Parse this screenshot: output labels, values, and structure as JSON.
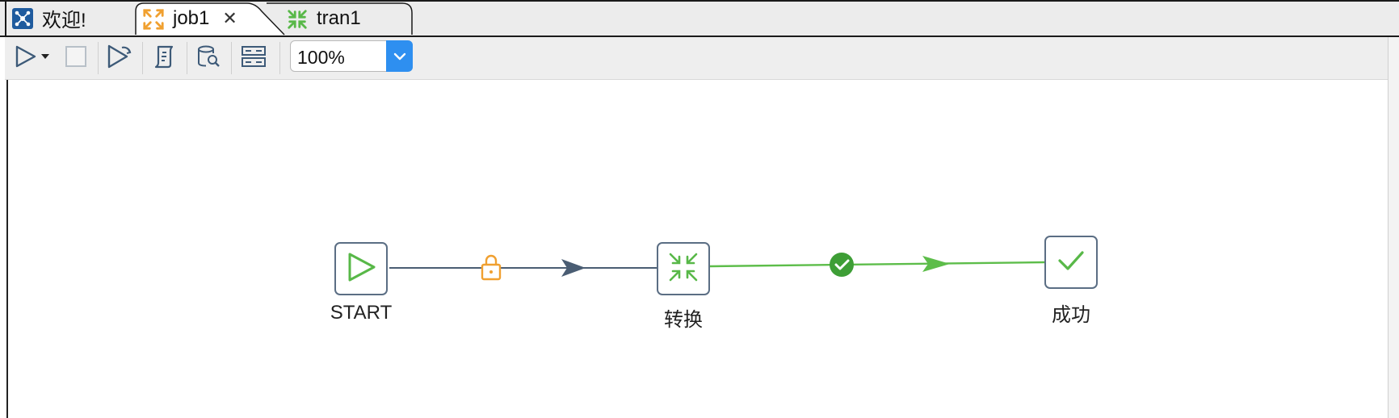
{
  "tabs": [
    {
      "label": "欢迎!",
      "icon": "welcome-icon",
      "active": false
    },
    {
      "label": "job1",
      "icon": "job-icon",
      "active": true,
      "closable": true
    },
    {
      "label": "tran1",
      "icon": "transformation-icon",
      "active": false
    }
  ],
  "toolbar": {
    "zoom_value": "100%",
    "buttons": [
      "run-icon",
      "run-dropdown-icon",
      "stop-icon",
      "preview-icon",
      "script-icon",
      "sql-explore-icon",
      "align-icon"
    ]
  },
  "canvas": {
    "nodes": [
      {
        "label": "START",
        "icon": "start-play-icon"
      },
      {
        "label": "转换",
        "icon": "transformation-icon"
      },
      {
        "label": "成功",
        "icon": "success-check-icon"
      }
    ],
    "hops": [
      {
        "from": "START",
        "to": "转换",
        "condition": "unconditional",
        "icon": "lock-icon",
        "color": "#4a5d73"
      },
      {
        "from": "转换",
        "to": "成功",
        "condition": "on-success",
        "icon": "check-circle-icon",
        "color": "#5dbd4a"
      }
    ]
  },
  "colors": {
    "accent_blue": "#2e8ff0",
    "hop_unconditional": "#4a5d73",
    "hop_success": "#5dbd4a",
    "lock_orange": "#f0a030",
    "job_orange": "#f0a030",
    "transform_green": "#58b848"
  }
}
